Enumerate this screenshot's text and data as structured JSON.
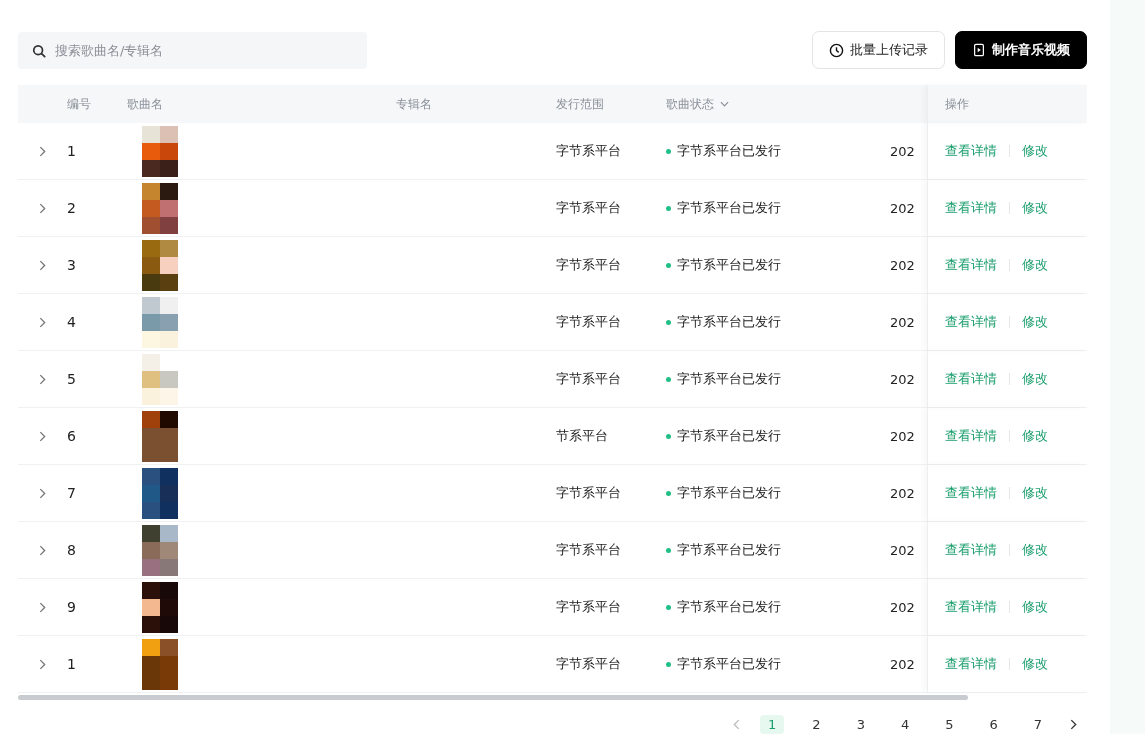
{
  "search": {
    "placeholder": "搜索歌曲名/专辑名"
  },
  "buttons": [
    {
      "label": "批量上传记录",
      "kind": "outline"
    },
    {
      "label": "制作音乐视频",
      "kind": "primary"
    }
  ],
  "table": {
    "columns": [
      {
        "label": "编号"
      },
      {
        "label": "歌曲名"
      },
      {
        "label": "专辑名"
      },
      {
        "label": "发行范围"
      },
      {
        "label": "歌曲状态",
        "sortable": true
      },
      {
        "label": "操作"
      }
    ],
    "rows": [
      {
        "no": "1",
        "scope": "字节系平台",
        "status": "字节系平台已发行",
        "color": "#1fbf86",
        "date": "202",
        "actions": [
          "查看详情",
          "修改"
        ]
      },
      {
        "no": "2",
        "scope": "字节系平台",
        "status": "字节系平台已发行",
        "color": "#1fbf86",
        "date": "202",
        "actions": [
          "查看详情",
          "修改"
        ]
      },
      {
        "no": "3",
        "scope": "字节系平台",
        "status": "字节系平台已发行",
        "color": "#1fbf86",
        "date": "202",
        "actions": [
          "查看详情",
          "修改"
        ]
      },
      {
        "no": "4",
        "scope": "字节系平台",
        "status": "字节系平台已发行",
        "color": "#1fbf86",
        "date": "202",
        "actions": [
          "查看详情",
          "修改"
        ]
      },
      {
        "no": "5",
        "scope": "字节系平台",
        "status": "字节系平台已发行",
        "color": "#1fbf86",
        "date": "202",
        "actions": [
          "查看详情",
          "修改"
        ]
      },
      {
        "no": "6",
        "scope": "节系平台",
        "status": "字节系平台已发行",
        "color": "#1fbf86",
        "date": "202",
        "actions": [
          "查看详情",
          "修改"
        ]
      },
      {
        "no": "7",
        "scope": "字节系平台",
        "status": "字节系平台已发行",
        "color": "#1fbf86",
        "date": "202",
        "actions": [
          "查看详情",
          "修改"
        ]
      },
      {
        "no": "8",
        "scope": "字节系平台",
        "status": "字节系平台已发行",
        "color": "#1fbf86",
        "date": "202",
        "actions": [
          "查看详情",
          "修改"
        ]
      },
      {
        "no": "9",
        "scope": "字节系平台",
        "status": "字节系平台已发行",
        "color": "#1fbf86",
        "date": "202",
        "actions": [
          "查看详情",
          "修改"
        ]
      },
      {
        "no": "1",
        "scope": "字节系平台",
        "status": "字节系平台已发行",
        "color": "#1fbf86",
        "date": "202",
        "actions": [
          "查看详情",
          "修改"
        ]
      }
    ]
  },
  "pagination": {
    "pages": [
      {
        "label": "1",
        "selected": true
      },
      {
        "label": "2",
        "selected": false
      },
      {
        "label": "3",
        "selected": false
      },
      {
        "label": "4",
        "selected": false
      },
      {
        "label": "5",
        "selected": false
      },
      {
        "label": "6",
        "selected": false
      },
      {
        "label": "7",
        "selected": false
      }
    ]
  }
}
